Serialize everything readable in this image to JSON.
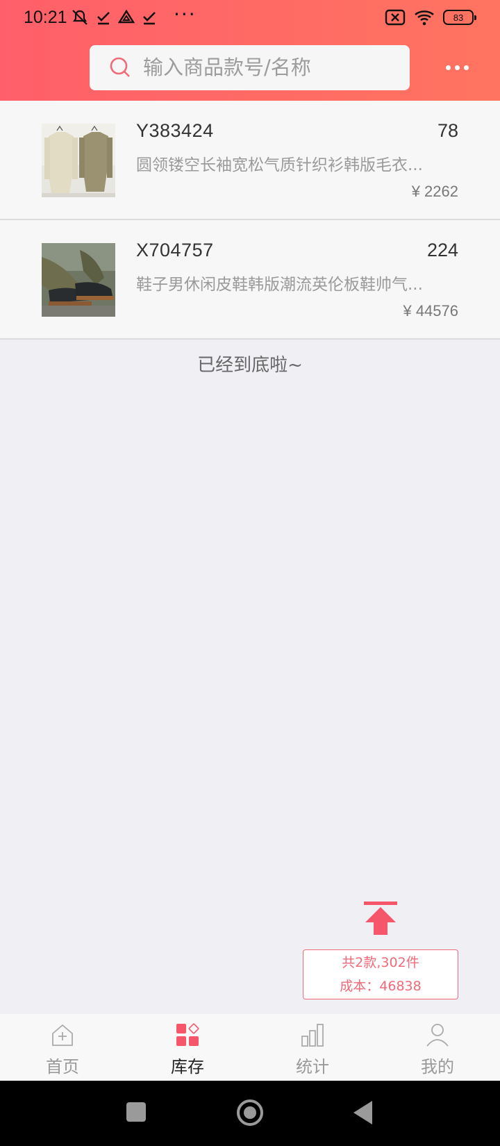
{
  "status_bar": {
    "time": "10:21",
    "battery": "83",
    "icons": [
      "mute-icon",
      "check-icon",
      "drive-icon",
      "check-icon",
      "more-dots",
      "sim-off-icon",
      "wifi-icon",
      "battery-icon"
    ]
  },
  "header": {
    "search_placeholder": "输入商品款号/名称",
    "more_icon": "more-icon",
    "gradient_start": "#ff5f6a",
    "gradient_end": "#ff7460"
  },
  "products": [
    {
      "code": "Y383424",
      "qty": "78",
      "desc": "圆领镂空长袖宽松气质针织衫韩版毛衣...",
      "price": "¥ 2262"
    },
    {
      "code": "X704757",
      "qty": "224",
      "desc": "鞋子男休闲皮鞋韩版潮流英伦板鞋帅气...",
      "price": "¥ 44576"
    }
  ],
  "end_text": "已经到底啦~",
  "summary": {
    "line1": "共2款,302件",
    "line2": "成本：46838",
    "accent": "#f06a78"
  },
  "tabs": [
    {
      "label": "首页",
      "icon": "home-icon",
      "active": false
    },
    {
      "label": "库存",
      "icon": "inventory-icon",
      "active": true
    },
    {
      "label": "统计",
      "icon": "stats-icon",
      "active": false
    },
    {
      "label": "我的",
      "icon": "profile-icon",
      "active": false
    }
  ]
}
